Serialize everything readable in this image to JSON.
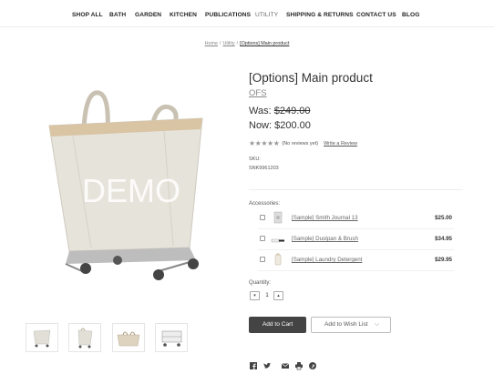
{
  "nav": {
    "items": [
      "SHOP ALL",
      "BATH",
      "GARDEN",
      "KITCHEN",
      "PUBLICATIONS",
      "UTILITY",
      "SHIPPING & RETURNS",
      "CONTACT US",
      "BLOG"
    ]
  },
  "breadcrumb": {
    "home": "Home",
    "category": "Utility",
    "current": "[Options] Main product",
    "separator": "/"
  },
  "product": {
    "image_text": "DEMO",
    "title": "[Options] Main product",
    "brand": "OFS",
    "was_label": "Was:",
    "was_price": "$249.00",
    "now_label": "Now:",
    "now_price": "$200.00",
    "reviews_text": "(No reviews yet)",
    "write_review": "Write a Review",
    "rating": 0,
    "sku_label": "SKU:",
    "sku_value": "SNK9961203"
  },
  "accessories": {
    "label": "Accessories:",
    "items": [
      {
        "name": "[Sample] Smith Journal 13",
        "price": "$25.00",
        "icon": "journal-icon"
      },
      {
        "name": "[Sample] Dustpan & Brush",
        "price": "$34.95",
        "icon": "dustpan-icon"
      },
      {
        "name": "[Sample] Laundry Detergent",
        "price": "$29.95",
        "icon": "detergent-icon"
      }
    ]
  },
  "quantity": {
    "label": "Quantity:",
    "value": "1",
    "decrease": "▾",
    "increase": "▴"
  },
  "actions": {
    "add_to_cart": "Add to Cart",
    "add_to_wishlist": "Add to Wish List"
  },
  "social": [
    "facebook-icon",
    "twitter-icon",
    "email-icon",
    "print-icon",
    "pinterest-icon"
  ],
  "colors": {
    "text": "#333333",
    "button_dark": "#444444",
    "muted": "#888888"
  }
}
